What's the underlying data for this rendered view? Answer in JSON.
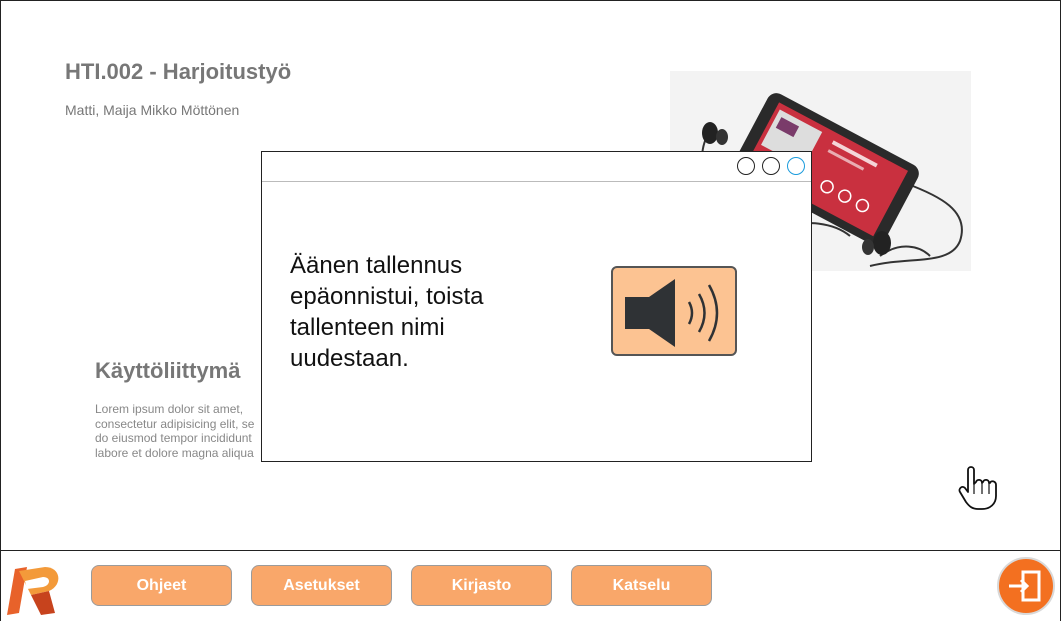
{
  "page": {
    "title": "HTI.002 - Harjoitustyö",
    "authors": "Matti, Maija Mikko Möttönen",
    "section_title": "Käyttöliittymä",
    "lorem": "Lorem ipsum dolor sit amet,\nconsectetur adipisicing elit, se\ndo eiusmod tempor incididunt\nlabore et dolore magna aliqua"
  },
  "dialog": {
    "message": "Äänen tallennus epäonnistui, toista tallenteen nimi uudestaan.",
    "icon": "speaker-volume-icon",
    "window_buttons": [
      "circle",
      "circle",
      "circle-blue"
    ]
  },
  "photo": {
    "icon": "smartphone-earphones-photo"
  },
  "footer": {
    "buttons": {
      "help": "Ohjeet",
      "settings": "Asetukset",
      "library": "Kirjasto",
      "view": "Katselu"
    },
    "exit_icon": "exit-icon",
    "logo_icon": "app-logo"
  },
  "colors": {
    "accent": "#f9a76a",
    "exit": "#f37020",
    "speaker_bg": "#fcc392",
    "title_gray": "#777777",
    "window_button_blue": "#1a9bdc"
  }
}
